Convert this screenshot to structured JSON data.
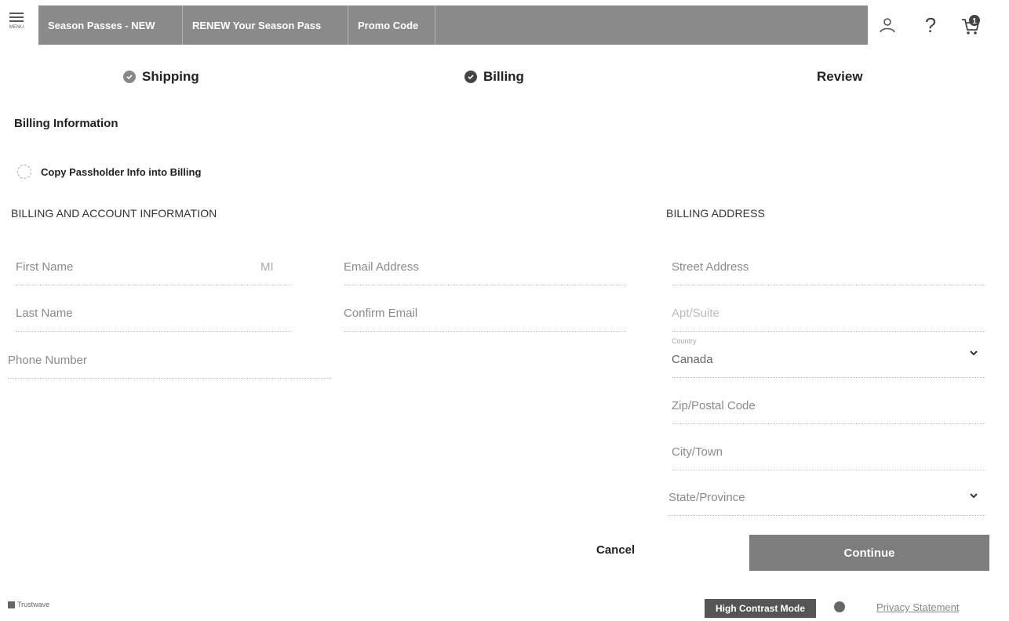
{
  "header": {
    "menu_label": "MENU",
    "nav_tabs": [
      {
        "label": "Season Passes - NEW"
      },
      {
        "label": "RENEW Your Season Pass"
      },
      {
        "label": "Promo Code"
      }
    ],
    "help_label": "?",
    "cart_count": "1"
  },
  "steps": [
    {
      "label": "Shipping",
      "state": "completed"
    },
    {
      "label": "Billing",
      "state": "current"
    },
    {
      "label": "Review",
      "state": "upcoming"
    }
  ],
  "billing": {
    "title": "Billing Information",
    "copy_label": "Copy Passholder Info into Billing",
    "account_heading": "BILLING AND ACCOUNT INFORMATION",
    "address_heading": "BILLING ADDRESS",
    "fields": {
      "first_name": "First Name",
      "middle_initial": "MI",
      "email": "Email Address",
      "last_name": "Last Name",
      "confirm_email": "Confirm Email",
      "phone": "Phone Number",
      "street": "Street Address",
      "apt": "Apt/Suite",
      "country_label": "Country",
      "country_value": "Canada",
      "zip": "Zip/Postal Code",
      "city": "City/Town",
      "state": "State/Province"
    }
  },
  "actions": {
    "cancel": "Cancel",
    "continue": "Continue"
  },
  "footer": {
    "logo_text": "Trustwave",
    "high_contrast": "High Contrast Mode",
    "privacy": "Privacy Statement"
  },
  "colors": {
    "nav_bg": "#8a8a8a",
    "continue_bg": "#7d7d7d",
    "hc_bg": "#555555"
  }
}
